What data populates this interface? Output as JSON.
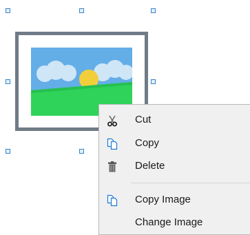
{
  "context_menu": {
    "items": [
      {
        "label": "Cut",
        "icon": "scissors-icon"
      },
      {
        "label": "Copy",
        "icon": "copy-icon"
      },
      {
        "label": "Delete",
        "icon": "trash-icon"
      },
      {
        "label": "Copy Image",
        "icon": "copy-icon"
      },
      {
        "label": "Change Image",
        "icon": ""
      }
    ]
  },
  "colors": {
    "handle_border": "#3b82c4",
    "frame": "#6f7b87",
    "menu_bg": "#f0f0f0",
    "sky": "#64aee8",
    "grass": "#2fd35a",
    "sun": "#f2cf3a"
  }
}
